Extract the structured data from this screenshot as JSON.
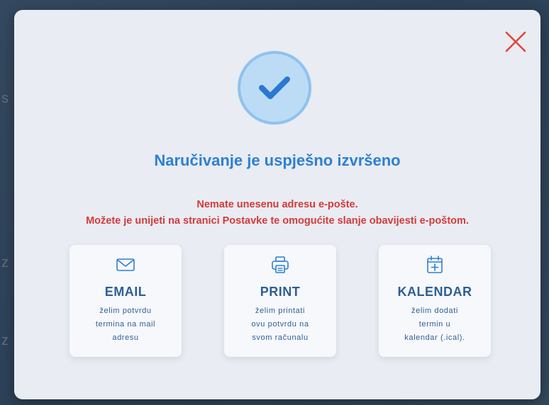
{
  "modal": {
    "title": "Naručivanje je uspješno izvršeno",
    "warning_line1": "Nemate unesenu adresu e-pošte.",
    "warning_line2": "Možete je unijeti na stranici Postavke te omogućite slanje obavijesti e-poštom.",
    "close_icon": "close-icon",
    "success_icon": "checkmark-icon"
  },
  "options": [
    {
      "icon": "mail-icon",
      "label": "EMAIL",
      "desc_line1": "želim potvrdu",
      "desc_line2": "termina na mail",
      "desc_line3": "adresu"
    },
    {
      "icon": "printer-icon",
      "label": "PRINT",
      "desc_line1": "želim printati",
      "desc_line2": "ovu potvrdu na",
      "desc_line3": "svom računalu"
    },
    {
      "icon": "calendar-add-icon",
      "label": "KALENDAR",
      "desc_line1": "želim dodati",
      "desc_line2": "termin u",
      "desc_line3": "kalendar (.ical)."
    }
  ],
  "colors": {
    "accent": "#2d7fd3",
    "warning": "#d43a3a",
    "close": "#e0463c",
    "card_text": "#2d5f96",
    "modal_bg": "#e9ecf2"
  }
}
